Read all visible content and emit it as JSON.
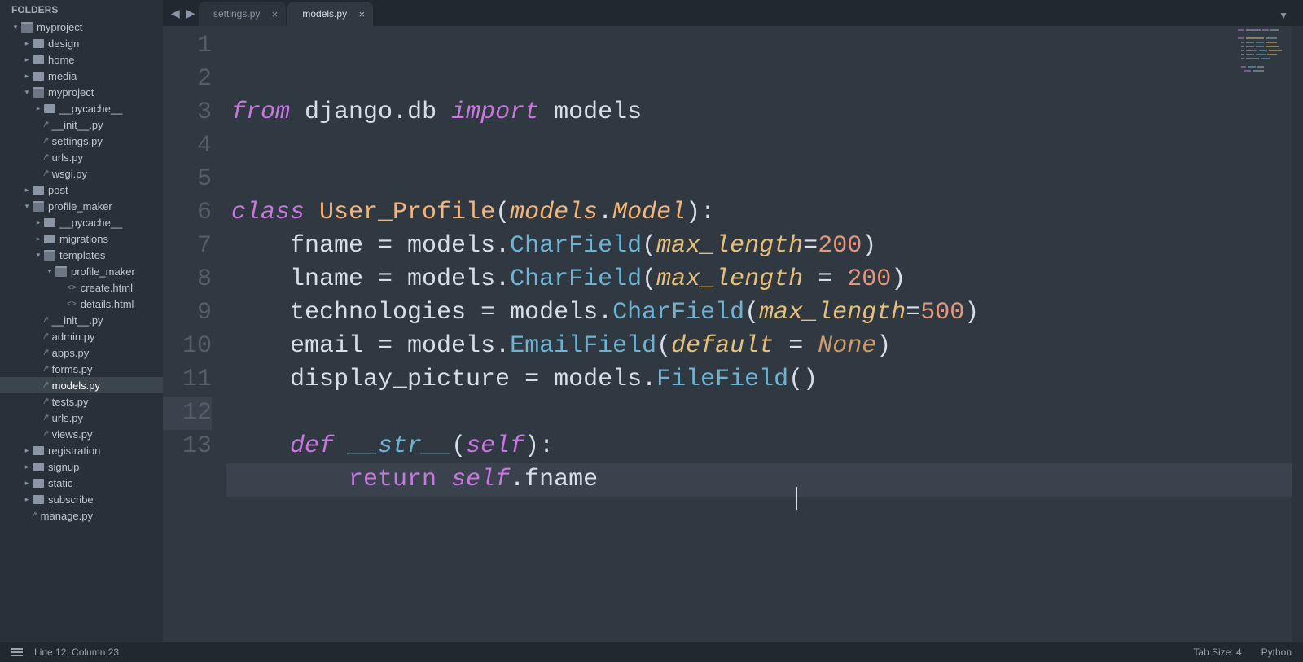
{
  "sidebar": {
    "title": "FOLDERS",
    "tree": [
      {
        "depth": 0,
        "arrow": "down",
        "icon": "open-folder",
        "label": "myproject"
      },
      {
        "depth": 1,
        "arrow": "right",
        "icon": "folder",
        "label": "design"
      },
      {
        "depth": 1,
        "arrow": "right",
        "icon": "folder",
        "label": "home"
      },
      {
        "depth": 1,
        "arrow": "right",
        "icon": "folder",
        "label": "media"
      },
      {
        "depth": 1,
        "arrow": "down",
        "icon": "open-folder",
        "label": "myproject"
      },
      {
        "depth": 2,
        "arrow": "right",
        "icon": "folder",
        "label": "__pycache__"
      },
      {
        "depth": 2,
        "arrow": "",
        "icon": "py",
        "label": "__init__.py"
      },
      {
        "depth": 2,
        "arrow": "",
        "icon": "py",
        "label": "settings.py"
      },
      {
        "depth": 2,
        "arrow": "",
        "icon": "py",
        "label": "urls.py"
      },
      {
        "depth": 2,
        "arrow": "",
        "icon": "py",
        "label": "wsgi.py"
      },
      {
        "depth": 1,
        "arrow": "right",
        "icon": "folder",
        "label": "post"
      },
      {
        "depth": 1,
        "arrow": "down",
        "icon": "open-folder",
        "label": "profile_maker"
      },
      {
        "depth": 2,
        "arrow": "right",
        "icon": "folder",
        "label": "__pycache__"
      },
      {
        "depth": 2,
        "arrow": "right",
        "icon": "folder",
        "label": "migrations"
      },
      {
        "depth": 2,
        "arrow": "down",
        "icon": "open-folder",
        "label": "templates"
      },
      {
        "depth": 3,
        "arrow": "down",
        "icon": "open-folder",
        "label": "profile_maker"
      },
      {
        "depth": 4,
        "arrow": "",
        "icon": "html",
        "label": "create.html"
      },
      {
        "depth": 4,
        "arrow": "",
        "icon": "html",
        "label": "details.html"
      },
      {
        "depth": 2,
        "arrow": "",
        "icon": "py",
        "label": "__init__.py"
      },
      {
        "depth": 2,
        "arrow": "",
        "icon": "py",
        "label": "admin.py"
      },
      {
        "depth": 2,
        "arrow": "",
        "icon": "py",
        "label": "apps.py"
      },
      {
        "depth": 2,
        "arrow": "",
        "icon": "py",
        "label": "forms.py"
      },
      {
        "depth": 2,
        "arrow": "",
        "icon": "py",
        "label": "models.py",
        "active": true
      },
      {
        "depth": 2,
        "arrow": "",
        "icon": "py",
        "label": "tests.py"
      },
      {
        "depth": 2,
        "arrow": "",
        "icon": "py",
        "label": "urls.py"
      },
      {
        "depth": 2,
        "arrow": "",
        "icon": "py",
        "label": "views.py"
      },
      {
        "depth": 1,
        "arrow": "right",
        "icon": "folder",
        "label": "registration"
      },
      {
        "depth": 1,
        "arrow": "right",
        "icon": "folder",
        "label": "signup"
      },
      {
        "depth": 1,
        "arrow": "right",
        "icon": "folder",
        "label": "static"
      },
      {
        "depth": 1,
        "arrow": "right",
        "icon": "folder",
        "label": "subscribe"
      },
      {
        "depth": 1,
        "arrow": "",
        "icon": "py",
        "label": "manage.py"
      }
    ]
  },
  "tabs": [
    {
      "label": "settings.py",
      "active": false
    },
    {
      "label": "models.py",
      "active": true
    }
  ],
  "code_lines_count": 13,
  "current_line_number": 12,
  "code": {
    "l1": [
      [
        "kw",
        "from"
      ],
      [
        "txt",
        " django"
      ],
      [
        "p",
        "."
      ],
      [
        "txt",
        "db "
      ],
      [
        "kw",
        "import"
      ],
      [
        "txt",
        " models"
      ]
    ],
    "l2": [],
    "l3": [],
    "l4": [
      [
        "kw",
        "class"
      ],
      [
        "txt",
        " "
      ],
      [
        "cls",
        "User_Profile"
      ],
      [
        "p",
        "("
      ],
      [
        "clsarg",
        "models"
      ],
      [
        "p",
        "."
      ],
      [
        "clsarg",
        "Model"
      ],
      [
        "p",
        "):"
      ]
    ],
    "l5": [
      [
        "txt",
        "    fname "
      ],
      [
        "op",
        "="
      ],
      [
        "txt",
        " models"
      ],
      [
        "p",
        "."
      ],
      [
        "fn",
        "CharField"
      ],
      [
        "p",
        "("
      ],
      [
        "kwarg",
        "max_length"
      ],
      [
        "op",
        "="
      ],
      [
        "num",
        "200"
      ],
      [
        "p",
        ")"
      ]
    ],
    "l6": [
      [
        "txt",
        "    lname "
      ],
      [
        "op",
        "="
      ],
      [
        "txt",
        " models"
      ],
      [
        "p",
        "."
      ],
      [
        "fn",
        "CharField"
      ],
      [
        "p",
        "("
      ],
      [
        "kwarg",
        "max_length"
      ],
      [
        "txt",
        " "
      ],
      [
        "op",
        "="
      ],
      [
        "txt",
        " "
      ],
      [
        "num",
        "200"
      ],
      [
        "p",
        ")"
      ]
    ],
    "l7": [
      [
        "txt",
        "    technologies "
      ],
      [
        "op",
        "="
      ],
      [
        "txt",
        " models"
      ],
      [
        "p",
        "."
      ],
      [
        "fn",
        "CharField"
      ],
      [
        "p",
        "("
      ],
      [
        "kwarg",
        "max_length"
      ],
      [
        "op",
        "="
      ],
      [
        "num",
        "500"
      ],
      [
        "p",
        ")"
      ]
    ],
    "l8": [
      [
        "txt",
        "    email "
      ],
      [
        "op",
        "="
      ],
      [
        "txt",
        " models"
      ],
      [
        "p",
        "."
      ],
      [
        "fn",
        "EmailField"
      ],
      [
        "p",
        "("
      ],
      [
        "kwarg",
        "default"
      ],
      [
        "txt",
        " "
      ],
      [
        "op",
        "="
      ],
      [
        "txt",
        " "
      ],
      [
        "none",
        "None"
      ],
      [
        "p",
        ")"
      ]
    ],
    "l9": [
      [
        "txt",
        "    display_picture "
      ],
      [
        "op",
        "="
      ],
      [
        "txt",
        " models"
      ],
      [
        "p",
        "."
      ],
      [
        "fn",
        "FileField"
      ],
      [
        "p",
        "()"
      ]
    ],
    "l10": [],
    "l11": [
      [
        "txt",
        "    "
      ],
      [
        "kw",
        "def"
      ],
      [
        "txt",
        " "
      ],
      [
        "fnmag",
        "__str__"
      ],
      [
        "p",
        "("
      ],
      [
        "self",
        "self"
      ],
      [
        "p",
        "):"
      ]
    ],
    "l12": [
      [
        "txt",
        "        "
      ],
      [
        "ret",
        "return"
      ],
      [
        "txt",
        " "
      ],
      [
        "self",
        "self"
      ],
      [
        "p",
        "."
      ],
      [
        "txt",
        "fname"
      ]
    ],
    "l13": []
  },
  "status": {
    "position": "Line 12, Column 23",
    "tab_size": "Tab Size: 4",
    "language": "Python"
  }
}
